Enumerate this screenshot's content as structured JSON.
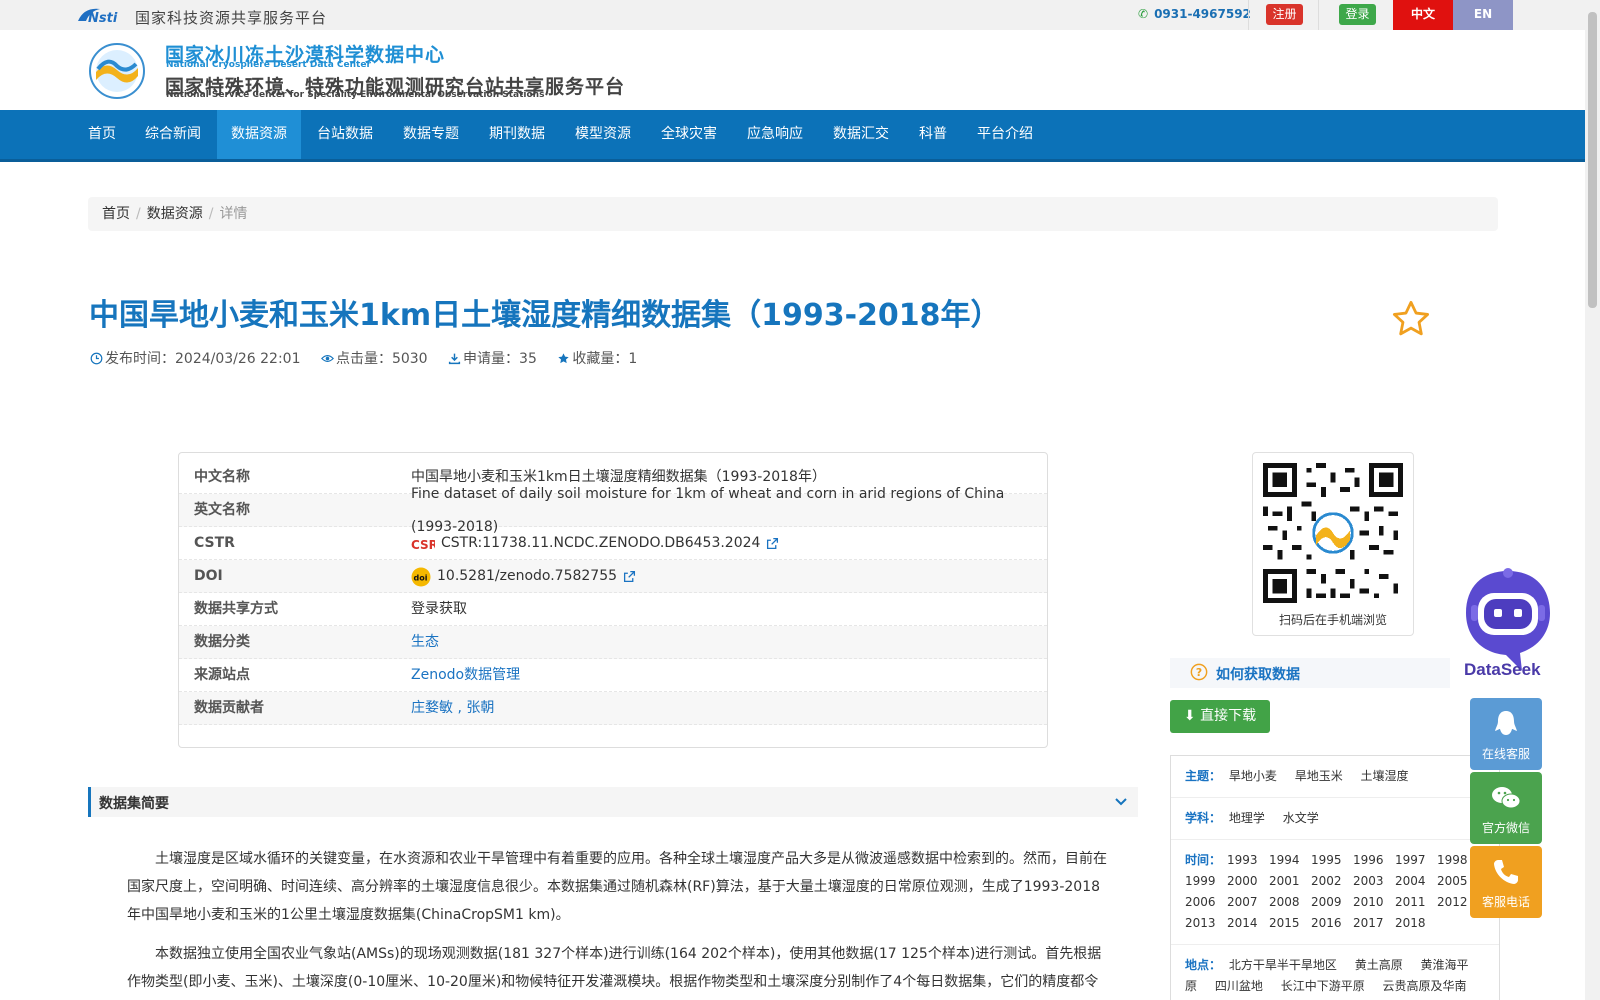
{
  "topbar": {
    "platform": "国家科技资源共享服务平台",
    "phone": "0931-4967592",
    "register": "注册",
    "login": "登录",
    "lang_zh": "中文",
    "lang_en": "EN"
  },
  "header": {
    "cn_title1": "国家冰川冻土沙漠科学数据中心",
    "en_title1": "National Cryosphere Desert Data Center",
    "cn_title2": "国家特殊环境、特殊功能观测研究台站共享服务平台",
    "en_title2": "National Service Center for Speciality Environmental Observation Stations"
  },
  "nav": {
    "items": [
      {
        "label": "首页"
      },
      {
        "label": "综合新闻"
      },
      {
        "label": "数据资源"
      },
      {
        "label": "台站数据"
      },
      {
        "label": "数据专题"
      },
      {
        "label": "期刊数据"
      },
      {
        "label": "模型资源"
      },
      {
        "label": "全球灾害"
      },
      {
        "label": "应急响应"
      },
      {
        "label": "数据汇交"
      },
      {
        "label": "科普"
      },
      {
        "label": "平台介绍"
      }
    ],
    "active_index": 2
  },
  "breadcrumb": {
    "home": "首页",
    "section": "数据资源",
    "current": "详情"
  },
  "dataset": {
    "title": "中国旱地小麦和玉米1km日土壤湿度精细数据集（1993-2018年）",
    "publish_time": "发布时间：2024/03/26 22:01",
    "clicks": "点击量：5030",
    "applications": "申请量：35",
    "favorites": "收藏量：1"
  },
  "info": {
    "rows": [
      {
        "label": "中文名称",
        "value": "中国旱地小麦和玉米1km日土壤湿度精细数据集（1993-2018年）"
      },
      {
        "label": "英文名称",
        "value": "Fine dataset of daily soil moisture for 1km of wheat and corn in arid regions of China (1993-2018)"
      },
      {
        "label": "CSTR",
        "value": "CSTR:11738.11.NCDC.ZENODO.DB6453.2024"
      },
      {
        "label": "DOI",
        "value": "10.5281/zenodo.7582755"
      },
      {
        "label": "数据共享方式",
        "value": "登录获取"
      },
      {
        "label": "数据分类",
        "value": "生态"
      },
      {
        "label": "来源站点",
        "value": "Zenodo数据管理"
      },
      {
        "label": "数据贡献者",
        "value": "庄婺敏 , 张朝"
      }
    ],
    "cstr_badge": "CSR",
    "doi_badge": "doi"
  },
  "qr": {
    "label": "扫码后在手机端浏览"
  },
  "howto": {
    "label": "如何获取数据",
    "download": "直接下载"
  },
  "tags": {
    "topic_label": "主题：",
    "topics": [
      "旱地小麦",
      "旱地玉米",
      "土壤湿度"
    ],
    "subject_label": "学科：",
    "subjects": [
      "地理学",
      "水文学"
    ],
    "time_label": "时间：",
    "years": [
      "1993",
      "1994",
      "1995",
      "1996",
      "1997",
      "1998",
      "1999",
      "2000",
      "2001",
      "2002",
      "2003",
      "2004",
      "2005",
      "2006",
      "2007",
      "2008",
      "2009",
      "2010",
      "2011",
      "2012",
      "2013",
      "2014",
      "2015",
      "2016",
      "2017",
      "2018"
    ],
    "place_label": "地点：",
    "places": [
      "北方干旱半干旱地区",
      "黄土高原",
      "黄淮海平原",
      "四川盆地",
      "长江中下游平原",
      "云贵高原及华南地"
    ]
  },
  "summary": {
    "title": "数据集简要",
    "para1": "土壤湿度是区域水循环的关键变量，在水资源和农业干旱管理中有着重要的应用。各种全球土壤湿度产品大多是从微波遥感数据中检索到的。然而，目前在国家尺度上，空间明确、时间连续、高分辨率的土壤湿度信息很少。本数据集通过随机森林(RF)算法，基于大量土壤湿度的日常原位观测，生成了1993-2018年中国旱地小麦和玉米的1公里土壤湿度数据集(ChinaCropSM1 km)。",
    "para2": "本数据独立使用全国农业气象站(AMSs)的现场观测数据(181 327个样本)进行训练(164 202个样本)，使用其他数据(17 125个样本)进行测试。首先根据作物类型(即小麦、玉米)、土壤深度(0-10厘米、10-20厘米)和物候特征开发灌溉模块。根据作物类型和土壤深度分别制作了4个每日数据集，它们的精度都令人满意"
  },
  "floating": {
    "dataseek": "DataSeek",
    "online_service": "在线客服",
    "wechat": "官方微信",
    "phone": "客服电话"
  },
  "colors": {
    "nav_bg": "#0c72b8",
    "title": "#1675bd",
    "link": "#1a73c2",
    "download": "#42a347",
    "register": "#d9342b",
    "login": "#3ea84a"
  }
}
